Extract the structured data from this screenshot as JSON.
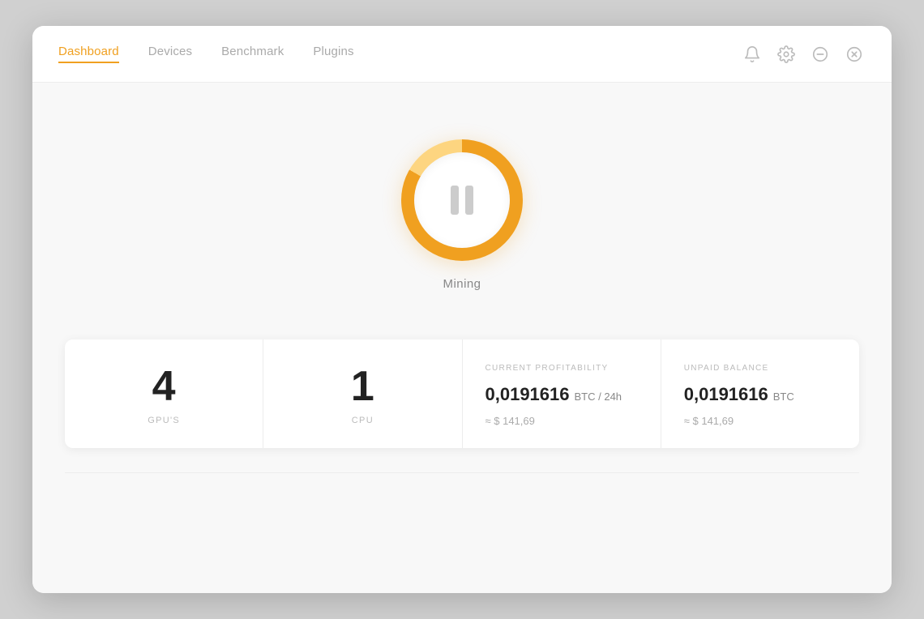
{
  "nav": {
    "tabs": [
      {
        "id": "dashboard",
        "label": "Dashboard",
        "active": true
      },
      {
        "id": "devices",
        "label": "Devices",
        "active": false
      },
      {
        "id": "benchmark",
        "label": "Benchmark",
        "active": false
      },
      {
        "id": "plugins",
        "label": "Plugins",
        "active": false
      }
    ]
  },
  "window_controls": {
    "notification_icon": "🔔",
    "settings_icon": "⚙",
    "minimize_icon": "⊖",
    "close_icon": "⊗"
  },
  "mining": {
    "label": "Mining",
    "status": "paused"
  },
  "stats": {
    "gpus": {
      "value": "4",
      "label": "GPU'S"
    },
    "cpu": {
      "value": "1",
      "label": "CPU"
    },
    "profitability": {
      "header": "CURRENT PROFITABILITY",
      "value": "0,0191616",
      "unit": "BTC / 24h",
      "approx": "≈ $ 141,69"
    },
    "balance": {
      "header": "UNPAID BALANCE",
      "value": "0,0191616",
      "unit": "BTC",
      "approx": "≈ $ 141,69"
    }
  }
}
